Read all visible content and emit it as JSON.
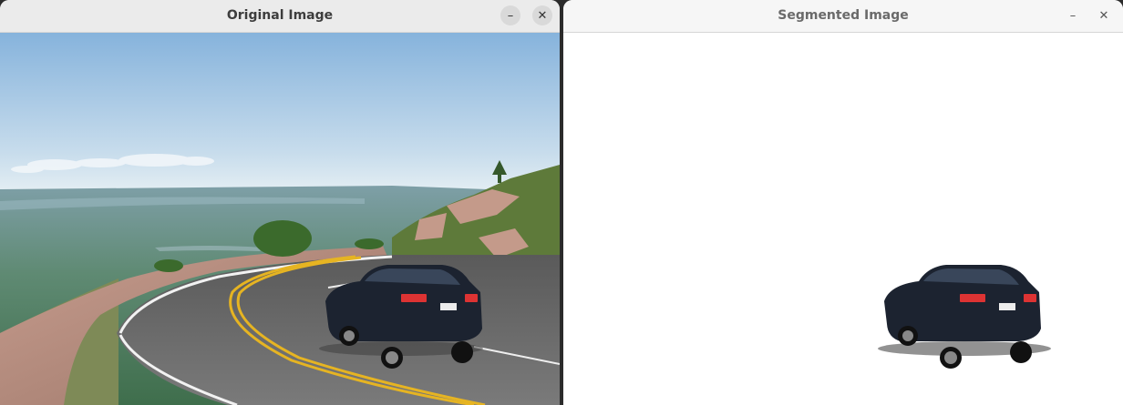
{
  "windows": [
    {
      "title": "Original Image",
      "minimize_glyph": "–",
      "close_glyph": "✕"
    },
    {
      "title": "Segmented Image",
      "minimize_glyph": "–",
      "close_glyph": "✕"
    }
  ],
  "icons": {
    "minimize": "minimize-icon",
    "close": "close-icon"
  },
  "colors": {
    "sky_top": "#8cb8dd",
    "sky_bottom": "#dce9f0",
    "forest": "#4d7a5f",
    "road": "#6b6b6b",
    "road_line": "#e6b422",
    "car": "#1c2330",
    "segmented_bg": "#ffffff"
  }
}
